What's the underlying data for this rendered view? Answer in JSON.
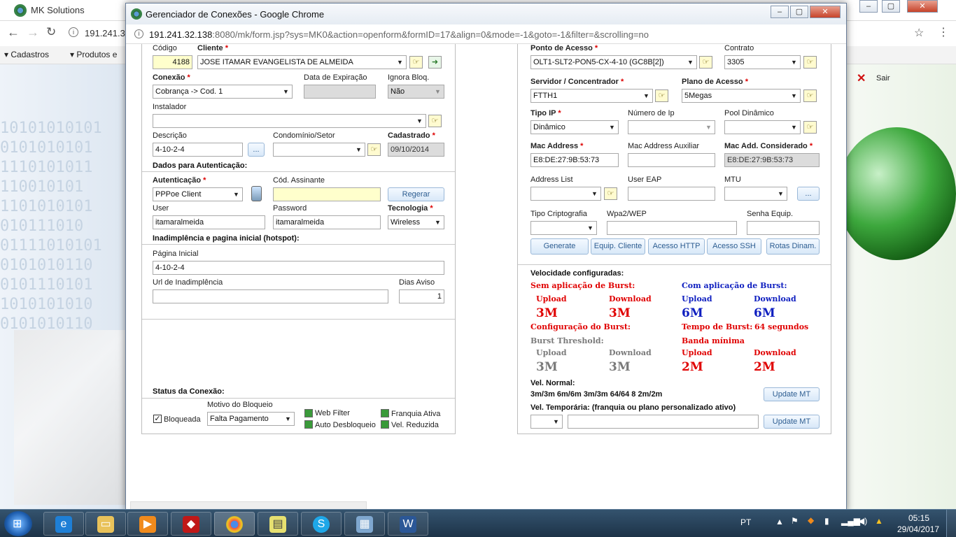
{
  "background_window": {
    "title": "MK Solutions",
    "address": "191.241.3",
    "menu": [
      "Cadastros",
      "Produtos e"
    ],
    "logout_label": "Sair"
  },
  "popup": {
    "title": "Gerenciador de Conexões - Google Chrome",
    "url_host": "191.241.32.138",
    "url_rest": ":8080/mk/form.jsp?sys=MK0&action=openform&formID=17&align=0&mode=-1&goto=-1&filter=&scrolling=no"
  },
  "left": {
    "codigo_label": "Código",
    "codigo_value": "4188",
    "cliente_label": "Cliente",
    "cliente_value": "JOSE ITAMAR EVANGELISTA DE ALMEIDA",
    "conexao_label": "Conexão",
    "conexao_value": "Cobrança -> Cod. 1",
    "expiracao_label": "Data de Expiração",
    "ignora_label": "Ignora Bloq.",
    "ignora_value": "Não",
    "instalador_label": "Instalador",
    "descricao_label": "Descrição",
    "descricao_value": "4-10-2-4",
    "desc_btn": "...",
    "condominio_label": "Condomínio/Setor",
    "cadastrado_label": "Cadastrado",
    "cadastrado_value": "09/10/2014",
    "auth_section": "Dados para Autenticação:",
    "autenticacao_label": "Autenticação",
    "autenticacao_value": "PPPoe Client",
    "assinante_label": "Cód. Assinante",
    "regerar_btn": "Regerar",
    "user_label": "User",
    "user_value": "itamaralmeida",
    "password_label": "Password",
    "password_value": "itamaralmeida",
    "tecnologia_label": "Tecnologia",
    "tecnologia_value": "Wireless",
    "hotspot_section": "Inadimplência e pagina inicial (hotspot):",
    "pagina_label": "Página Inicial",
    "pagina_value": "4-10-2-4",
    "url_inad_label": "Url de Inadimplência",
    "dias_label": "Dias Aviso",
    "dias_value": "1",
    "status_section": "Status da Conexão:",
    "bloqueada_label": "Bloqueada",
    "motivo_label": "Motivo do Bloqueio",
    "motivo_value": "Falta Pagamento",
    "web_filter": "Web Filter",
    "auto_desbloqueio": "Auto Desbloqueio",
    "franquia": "Franquia Ativa",
    "vel_reduzida": "Vel. Reduzida"
  },
  "right": {
    "ponto_label": "Ponto de Acesso",
    "ponto_value": "OLT1-SLT2-PON5-CX-4-10 (GC8B[2])",
    "contrato_label": "Contrato",
    "contrato_value": "3305",
    "servidor_label": "Servidor / Concentrador",
    "servidor_value": "FTTH1",
    "plano_label": "Plano de Acesso",
    "plano_value": "5Megas",
    "tipoip_label": "Tipo IP",
    "tipoip_value": "Dinâmico",
    "numip_label": "Número de Ip",
    "pool_label": "Pool Dinâmico",
    "mac_label": "Mac Address",
    "mac_value": "E8:DE:27:9B:53:73",
    "macaux_label": "Mac Address Auxiliar",
    "maccons_label": "Mac Add. Considerado",
    "maccons_value": "E8:DE:27:9B:53:73",
    "addrlist_label": "Address List",
    "usereap_label": "User EAP",
    "mtu_label": "MTU",
    "mtu_btn": "...",
    "cripto_label": "Tipo Criptografia",
    "wpa_label": "Wpa2/WEP",
    "senha_label": "Senha Equip.",
    "buttons": [
      "Generate",
      "Equip. Cliente",
      "Acesso HTTP",
      "Acesso SSH",
      "Rotas Dinam."
    ],
    "vel_title": "Velocidade configuradas:",
    "sem_burst": "Sem aplicação de Burst:",
    "com_burst": "Com aplicação de Burst:",
    "upload": "Upload",
    "download": "Download",
    "sem_up": "3M",
    "sem_down": "3M",
    "com_up": "6M",
    "com_down": "6M",
    "config_burst": "Configuração do Burst:",
    "tempo_burst": "Tempo de Burst:",
    "tempo_value": "64 segundos",
    "threshold": "Burst Threshold:",
    "banda_minima": "Banda mínima",
    "thr_up": "3M",
    "thr_down": "3M",
    "min_up": "2M",
    "min_down": "2M",
    "vel_normal_label": "Vel. Normal:",
    "vel_normal_value": "3m/3m 6m/6m 3m/3m 64/64 8 2m/2m",
    "update_mt": "Update MT",
    "vel_temp_label": "Vel. Temporária: (franquia ou plano personalizado ativo)"
  },
  "taskbar": {
    "lang": "PT",
    "time": "05:15",
    "date": "29/04/2017"
  },
  "colors": {
    "required": "#dd0000",
    "burst_red": "#e00000",
    "burst_blue": "#1020c0",
    "button_text": "#2d5d91"
  }
}
